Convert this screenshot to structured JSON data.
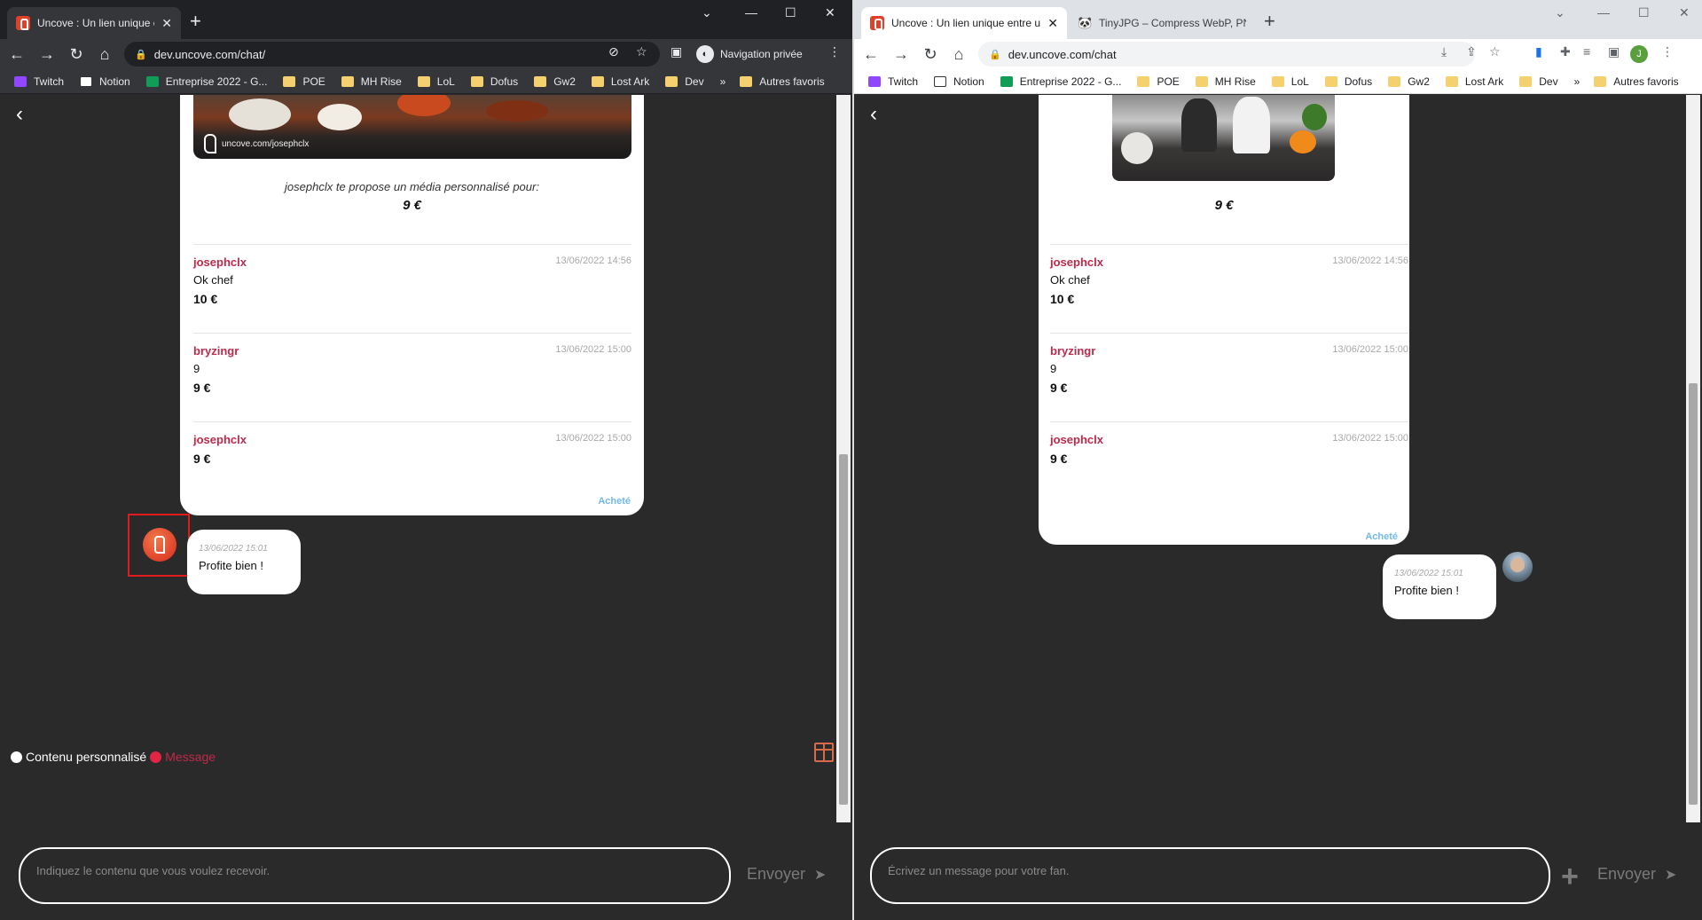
{
  "left": {
    "tab_title": "Uncove : Un lien unique entre un",
    "url": "dev.uncove.com/chat/",
    "incognito_label": "Navigation privée",
    "bookmarks": [
      "Twitch",
      "Notion",
      "Entreprise 2022 - G...",
      "POE",
      "MH Rise",
      "LoL",
      "Dofus",
      "Gw2",
      "Lost Ark",
      "Dev"
    ],
    "other_bookmarks": "Autres favoris",
    "media_watermark": "uncove.com/josephclx",
    "proposal_text": "josephclx te propose un média personnalisé pour:",
    "proposal_price": "9 €",
    "offers": [
      {
        "user": "josephclx",
        "time": "13/06/2022 14:56",
        "message": "Ok chef",
        "amount": "10 €"
      },
      {
        "user": "bryzingr",
        "time": "13/06/2022 15:00",
        "message": "9",
        "amount": "9 €"
      },
      {
        "user": "josephclx",
        "time": "13/06/2022 15:00",
        "message": "",
        "amount": "9 €"
      }
    ],
    "bought_label": "Acheté",
    "bubble": {
      "time": "13/06/2022 15:01",
      "text": "Profite bien !"
    },
    "mode_custom": "Contenu personnalisé",
    "mode_message": "Message",
    "input_placeholder": "Indiquez le contenu que vous voulez recevoir.",
    "send_label": "Envoyer"
  },
  "right": {
    "tab_title": "Uncove : Un lien unique entre un",
    "tab2_title": "TinyJPG – Compress WebP, PNG",
    "url": "dev.uncove.com/chat",
    "profile_initial": "J",
    "bookmarks": [
      "Twitch",
      "Notion",
      "Entreprise 2022 - G...",
      "POE",
      "MH Rise",
      "LoL",
      "Dofus",
      "Gw2",
      "Lost Ark",
      "Dev"
    ],
    "other_bookmarks": "Autres favoris",
    "proposal_price": "9 €",
    "offers": [
      {
        "user": "josephclx",
        "time": "13/06/2022 14:56",
        "message": "Ok chef",
        "amount": "10 €"
      },
      {
        "user": "bryzingr",
        "time": "13/06/2022 15:00",
        "message": "9",
        "amount": "9 €"
      },
      {
        "user": "josephclx",
        "time": "13/06/2022 15:00",
        "message": "",
        "amount": "9 €"
      }
    ],
    "bought_label": "Acheté",
    "bubble": {
      "time": "13/06/2022 15:01",
      "text": "Profite bien !"
    },
    "input_placeholder": "Écrivez un message pour votre fan.",
    "send_label": "Envoyer"
  },
  "colors": {
    "username": "#c0294a",
    "bought": "#74b9e8",
    "accent": "#e0412b",
    "page_bg": "#2a2a2a"
  }
}
